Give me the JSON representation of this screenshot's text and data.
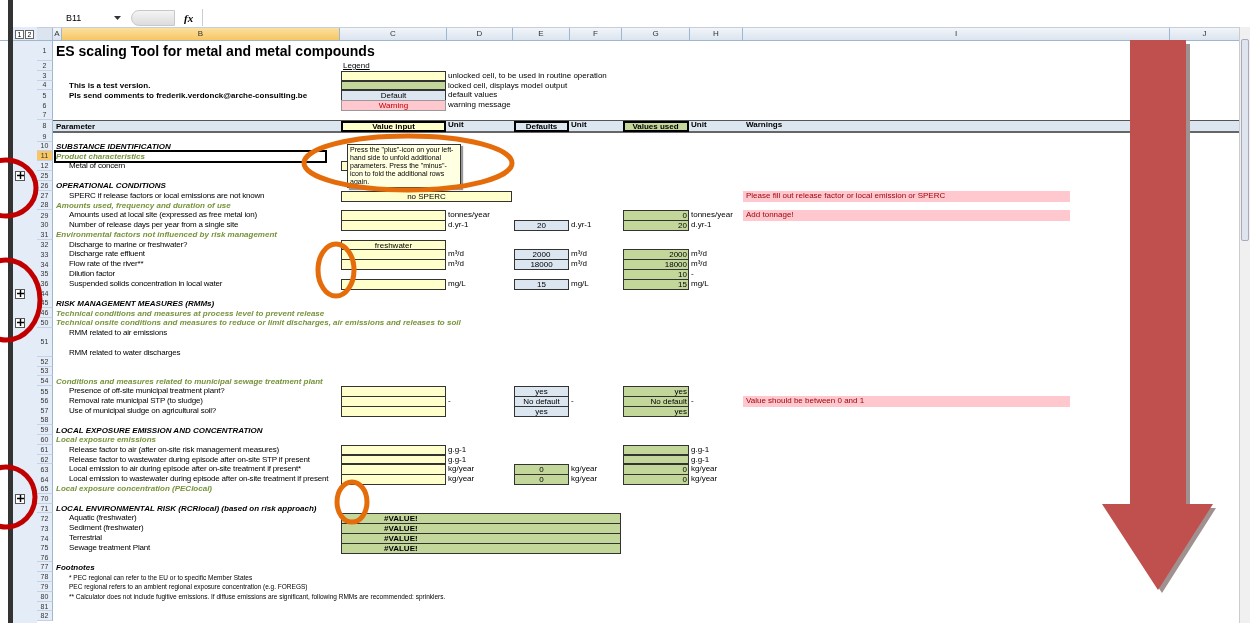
{
  "formula_bar": {
    "cell": "B11",
    "function_label": "fx"
  },
  "outline_levels": [
    "1",
    "2"
  ],
  "columns": [
    {
      "label": "A",
      "selected": false
    },
    {
      "label": "B",
      "selected": true
    },
    {
      "label": "C",
      "selected": false
    },
    {
      "label": "D",
      "selected": false
    },
    {
      "label": "E",
      "selected": false
    },
    {
      "label": "F",
      "selected": false
    },
    {
      "label": "G",
      "selected": false
    },
    {
      "label": "H",
      "selected": false
    },
    {
      "label": "I",
      "selected": false
    },
    {
      "label": "J",
      "selected": false
    }
  ],
  "comment": {
    "text": "Press the \"plus\"-icon on your left-hand side to unfold additional parameters. Press the \"minus\"-icon to fold the additional rows again."
  },
  "rows": [
    {
      "num": "1",
      "kind": "title",
      "selected": false,
      "label": "ES scaling Tool for metal and metal compounds"
    },
    {
      "num": "2",
      "kind": "blank",
      "selected": false,
      "legend_title": "Legend"
    },
    {
      "num": "3",
      "kind": "blank",
      "selected": false,
      "c": {
        "kind": "input"
      },
      "d": "unlocked cell, to be used in routine operation"
    },
    {
      "num": "4",
      "kind": "note",
      "selected": false,
      "label": "This is a test version.",
      "c": {
        "kind": "locked"
      },
      "d": "locked cell, displays model output"
    },
    {
      "num": "5",
      "kind": "note",
      "selected": false,
      "label": "Pls send comments to frederik.verdonck@arche-consulting.be",
      "c": {
        "kind": "default",
        "value": "Default"
      },
      "d": "default values"
    },
    {
      "num": "6",
      "kind": "blank",
      "selected": false,
      "c": {
        "kind": "warning",
        "value": "Warning"
      },
      "d": "warning message"
    },
    {
      "num": "7",
      "kind": "blank",
      "selected": false
    },
    {
      "num": "8",
      "kind": "header",
      "selected": false,
      "label": "Parameter",
      "c": {
        "kind": "input",
        "value": "Value input"
      },
      "d": "Unit",
      "e": {
        "kind": "default",
        "value": "Defaults"
      },
      "f": "Unit",
      "g": {
        "value": "Values used"
      },
      "h": "Unit",
      "i": "Warnings"
    },
    {
      "num": "9",
      "kind": "blank",
      "selected": false
    },
    {
      "num": "10",
      "kind": "section",
      "selected": false,
      "label": "SUBSTANCE IDENTIFICATION"
    },
    {
      "num": "11",
      "kind": "subsection",
      "selected": true,
      "label": "Product characteristics"
    },
    {
      "num": "12",
      "kind": "param",
      "selected": false,
      "label": "Metal of concern",
      "c": {
        "kind": "input"
      }
    },
    {
      "num": "25",
      "kind": "blank",
      "selected": false,
      "toggle": {
        "collapsed": true
      }
    },
    {
      "num": "26",
      "kind": "section",
      "selected": false,
      "label": "OPERATIONAL CONDITIONS"
    },
    {
      "num": "27",
      "kind": "param",
      "selected": false,
      "label": "SPERC  if release factors or local emissions are not known",
      "c": {
        "kind": "choice",
        "value": "no SPERC"
      },
      "warning": "Please fill out release factor or local emission or SPERC"
    },
    {
      "num": "28",
      "kind": "subsection",
      "selected": false,
      "label": "Amounts used, frequency and duration of use"
    },
    {
      "num": "29",
      "kind": "param",
      "selected": false,
      "label": "Amounts used at local site (expressed as free metal ion)",
      "c": {
        "kind": "input"
      },
      "d": "tonnes/year",
      "g": {
        "value": "0"
      },
      "h": "tonnes/year",
      "warning": "Add tonnage!"
    },
    {
      "num": "30",
      "kind": "param",
      "selected": false,
      "label": "Number of release days per year from a single site",
      "c": {
        "kind": "input"
      },
      "d": "d.yr-1",
      "e": {
        "kind": "default",
        "value": "20"
      },
      "f": "d.yr-1",
      "g": {
        "value": "20"
      },
      "h": "d.yr-1"
    },
    {
      "num": "31",
      "kind": "subsection",
      "selected": false,
      "label": "Environmental factors not influenced by risk management"
    },
    {
      "num": "32",
      "kind": "param",
      "selected": false,
      "label": "Discharge to marine or freshwater?",
      "c": {
        "kind": "input",
        "value": "freshwater"
      }
    },
    {
      "num": "33",
      "kind": "param",
      "selected": false,
      "label": "Discharge rate effluent",
      "c": {
        "kind": "input"
      },
      "d": "m³/d",
      "e": {
        "kind": "default",
        "value": "2000"
      },
      "f": "m³/d",
      "g": {
        "value": "2000"
      },
      "h": "m³/d"
    },
    {
      "num": "34",
      "kind": "param",
      "selected": false,
      "label": "Flow rate of the river**",
      "c": {
        "kind": "input"
      },
      "d": "m³/d",
      "e": {
        "kind": "default",
        "value": "18000"
      },
      "f": "m³/d",
      "g": {
        "value": "18000"
      },
      "h": "m³/d"
    },
    {
      "num": "35",
      "kind": "param",
      "selected": false,
      "label": "Dilution factor",
      "g": {
        "value": "10"
      },
      "h": "-"
    },
    {
      "num": "36",
      "kind": "param",
      "selected": false,
      "label": "Suspended solids concentration in local water",
      "c": {
        "kind": "input"
      },
      "d": "mg/L",
      "e": {
        "kind": "default",
        "value": "15"
      },
      "f": "mg/L",
      "g": {
        "value": "15"
      },
      "h": "mg/L"
    },
    {
      "num": "44",
      "kind": "blank",
      "selected": false,
      "toggle": {
        "collapsed": true
      }
    },
    {
      "num": "45",
      "kind": "section",
      "selected": false,
      "label": "RISK MANAGEMENT MEASURES (RMMs)"
    },
    {
      "num": "46",
      "kind": "subsection",
      "selected": false,
      "label": "Technical conditions and measures at process level to prevent release"
    },
    {
      "num": "50",
      "kind": "subsection",
      "selected": false,
      "label": "Technical onsite conditions and measures to reduce or limit discharges, air emissions and releases to soil",
      "toggle": {
        "collapsed": true
      }
    },
    {
      "num": "51",
      "kind": "param",
      "selected": false,
      "label": "RMM related to air emissions",
      "label_2": "RMM related to water discharges"
    },
    {
      "num": "52",
      "kind": "blank",
      "selected": false
    },
    {
      "num": "53",
      "kind": "blank",
      "selected": false
    },
    {
      "num": "54",
      "kind": "subsection",
      "selected": false,
      "label": "Conditions and measures related to municipal sewage treatment plant"
    },
    {
      "num": "55",
      "kind": "param",
      "selected": false,
      "label": "Presence of off-site municipal treatment plant?",
      "c": {
        "kind": "input"
      },
      "e": {
        "kind": "default",
        "value": "yes"
      },
      "g": {
        "value": "yes"
      }
    },
    {
      "num": "56",
      "kind": "param",
      "selected": false,
      "label": "Removal rate municipal STP (to sludge)",
      "c": {
        "kind": "input"
      },
      "d": "-",
      "e": {
        "kind": "default",
        "value": "No default"
      },
      "f": "-",
      "g": {
        "value": "No default"
      },
      "h": "-",
      "warning": "Value should be between 0 and 1"
    },
    {
      "num": "57",
      "kind": "param",
      "selected": false,
      "label": "Use of municipal sludge on agricultural soil?",
      "c": {
        "kind": "input"
      },
      "e": {
        "kind": "default",
        "value": "yes"
      },
      "g": {
        "value": "yes"
      }
    },
    {
      "num": "58",
      "kind": "blank",
      "selected": false
    },
    {
      "num": "59",
      "kind": "section",
      "selected": false,
      "label": "LOCAL EXPOSURE EMISSION AND CONCENTRATION"
    },
    {
      "num": "60",
      "kind": "subsection",
      "selected": false,
      "label": "Local exposure emissions"
    },
    {
      "num": "61",
      "kind": "param",
      "selected": false,
      "label": "Release factor to air (after on-site risk management measures)",
      "c": {
        "kind": "input"
      },
      "d": "g.g-1",
      "g": {},
      "h": "g.g-1"
    },
    {
      "num": "62",
      "kind": "param",
      "selected": false,
      "label": "Release factor to wastewater during episode after on-site STP if present",
      "c": {
        "kind": "input"
      },
      "d": "g.g-1",
      "g": {},
      "h": "g.g-1"
    },
    {
      "num": "63",
      "kind": "param",
      "selected": false,
      "label": "Local emission to air during episode after on-site treatment if present*",
      "c": {
        "kind": "input"
      },
      "d": "kg/year",
      "e": {
        "kind": "locked",
        "value": "0"
      },
      "f": "kg/year",
      "g": {
        "value": "0"
      },
      "h": "kg/year"
    },
    {
      "num": "64",
      "kind": "param",
      "selected": false,
      "label": "Local emission to wastewater during episode after on-site treatment if present",
      "c": {
        "kind": "input"
      },
      "d": "kg/year",
      "e": {
        "kind": "locked",
        "value": "0"
      },
      "f": "kg/year",
      "g": {
        "value": "0"
      },
      "h": "kg/year"
    },
    {
      "num": "65",
      "kind": "subsection",
      "selected": false,
      "label": "Local exposure concentration (PEClocal)"
    },
    {
      "num": "70",
      "kind": "blank",
      "selected": false,
      "toggle": {
        "collapsed": true
      }
    },
    {
      "num": "71",
      "kind": "section",
      "selected": false,
      "label": "LOCAL ENVIRONMENTAL RISK (RCRlocal) (based on  risk approach)"
    },
    {
      "num": "72",
      "kind": "param",
      "selected": false,
      "label": "Aquatic (freshwater)",
      "c": {
        "kind": "result",
        "value": "#VALUE!"
      }
    },
    {
      "num": "73",
      "kind": "param",
      "selected": false,
      "label": "Sediment (freshwater)",
      "c": {
        "kind": "result",
        "value": "#VALUE!"
      }
    },
    {
      "num": "74",
      "kind": "param",
      "selected": false,
      "label": "Terrestrial",
      "c": {
        "kind": "result",
        "value": "#VALUE!"
      }
    },
    {
      "num": "75",
      "kind": "param",
      "selected": false,
      "label": "Sewage treatment Plant",
      "c": {
        "kind": "result",
        "value": "#VALUE!"
      }
    },
    {
      "num": "76",
      "kind": "blank",
      "selected": false
    },
    {
      "num": "77",
      "kind": "section",
      "selected": false,
      "label": "Footnotes"
    },
    {
      "num": "78",
      "kind": "footnote",
      "selected": false,
      "label": "* PEC regional can refer to the EU or to specific Member States"
    },
    {
      "num": "79",
      "kind": "footnote",
      "selected": false,
      "label": "PEC regional refers to an ambient regional exposure concentration (e.g. FOREGS)"
    },
    {
      "num": "80",
      "kind": "footnote",
      "selected": false,
      "label": "** Calculator does not include fugitive emissions. If diffuse emissions are significant, following RMMs are recommended: sprinklers."
    },
    {
      "num": "81",
      "kind": "blank",
      "selected": false
    },
    {
      "num": "82",
      "kind": "blank",
      "selected": false
    }
  ]
}
